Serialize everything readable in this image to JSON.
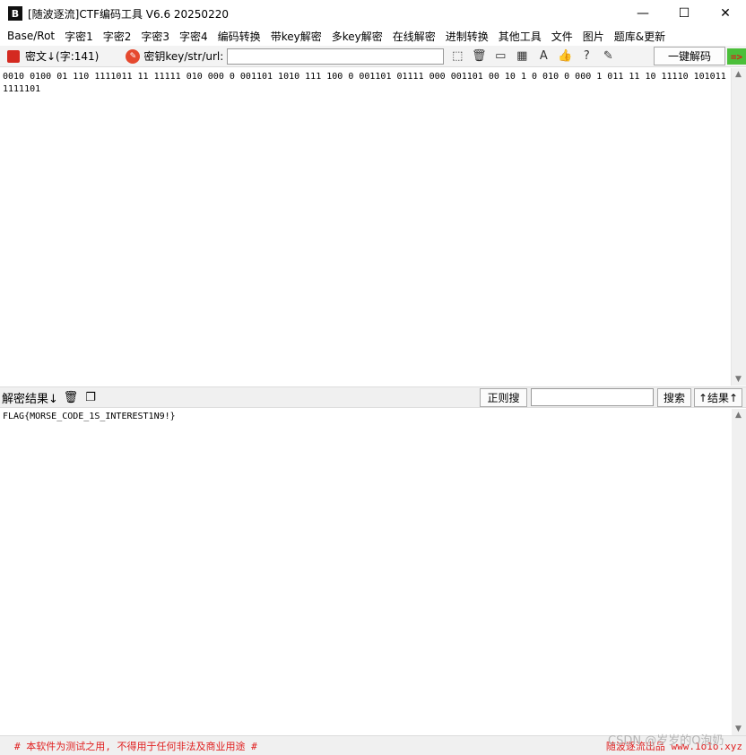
{
  "window": {
    "title": "[随波逐流]CTF编码工具 V6.6 20250220",
    "icon_text": "B",
    "minimize_glyph": "—",
    "maximize_glyph": "☐",
    "close_glyph": "✕"
  },
  "menu": [
    "Base/Rot",
    "字密1",
    "字密2",
    "字密3",
    "字密4",
    "编码转换",
    "带key解密",
    "多key解密",
    "在线解密",
    "进制转换",
    "其他工具",
    "文件",
    "图片",
    "题库&更新"
  ],
  "toolbar": {
    "cipher_label": "密文↓(字:141)",
    "key_label": "密钥key/str/url:",
    "key_value": "",
    "decode_button": "一键解码",
    "arrow_indicator": "=>",
    "icons": [
      "select-icon",
      "trash-icon",
      "terminal-icon",
      "grid-icon",
      "font-icon",
      "thumbs-up-icon",
      "help-icon",
      "edit-icon"
    ]
  },
  "input": {
    "text": "0010 0100 01 110 1111011 11 11111 010 000 0 001101 1010 111 100 0 001101 01111 000 001101 00 10 1 0 010 0 000 1 011 11 10 11110 101011 1111101"
  },
  "result_bar": {
    "label": "解密结果↓",
    "regex_button": "正则搜",
    "search_value": "",
    "search_button": "搜索",
    "result_button": "↑结果↑"
  },
  "output": {
    "text": "FLAG{MORSE_CODE_1S_INTEREST1N9!}"
  },
  "status": {
    "left": "# 本软件为测试之用, 不得用于任何非法及商业用途 #",
    "right": "随波逐流出品 www.1o1o.xyz",
    "watermark": "CSDN @岁岁的O泡奶"
  },
  "colors": {
    "accent_red": "#e02020",
    "indicator_green": "#4bbf3a"
  }
}
